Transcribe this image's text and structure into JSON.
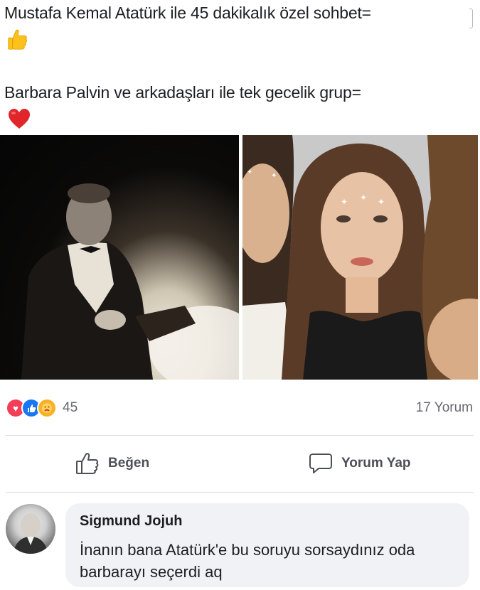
{
  "post": {
    "line1": "Mustafa Kemal Atatürk ile 45 dakikalık özel sohbet=",
    "line1_emoji": "thumbs-up-emoji",
    "line2": "Barbara Palvin ve arkadaşları ile tek gecelik  grup=",
    "line2_emoji": "red-heart-emoji"
  },
  "reactions": {
    "icons": [
      "love-reaction-icon",
      "like-reaction-icon",
      "care-reaction-icon"
    ],
    "count": "45"
  },
  "comments_count": "17 Yorum",
  "actions": {
    "like_label": "Beğen",
    "comment_label": "Yorum Yap"
  },
  "comment": {
    "author": "Sigmund Jojuh",
    "text": "İnanın bana Atatürk'e bu soruyu sorsaydınız oda barbarayı seçerdi aq"
  },
  "colors": {
    "like_blue": "#1877f2",
    "love_red": "#f33e58",
    "care_yellow": "#f7b125",
    "muted_text": "#65676b",
    "bubble_bg": "#f0f2f5"
  }
}
